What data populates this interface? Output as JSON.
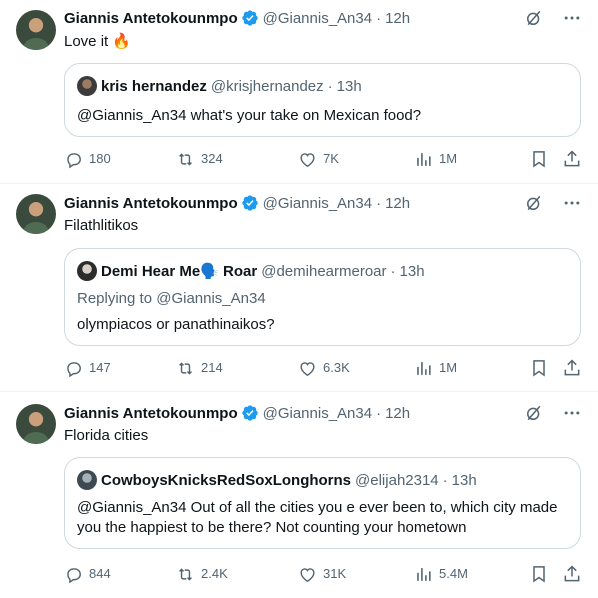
{
  "colors": {
    "accent": "#1d9bf0",
    "muted": "#536471",
    "text": "#0f1419",
    "border": "#cfd9de"
  },
  "tweets": [
    {
      "author": {
        "name": "Giannis Antetokounmpo",
        "handle": "@Giannis_An34",
        "time": "12h",
        "verified_icon": "verified-badge-icon"
      },
      "text": "Love it 🔥",
      "quote": {
        "name": "kris hernandez",
        "handle": "@krisjhernandez",
        "time": "13h",
        "replying": "",
        "lines": [
          "@Giannis_An34 what's your take on Mexican food?"
        ]
      },
      "stats": {
        "replies": "180",
        "reposts": "324",
        "likes": "7K",
        "views": "1M"
      }
    },
    {
      "author": {
        "name": "Giannis Antetokounmpo",
        "handle": "@Giannis_An34",
        "time": "12h",
        "verified_icon": "verified-badge-icon"
      },
      "text": "Filathlitikos",
      "quote": {
        "name": "Demi Hear Me🗣️ Roar",
        "handle": "@demihearmeroar",
        "time": "13h",
        "replying": "Replying to @Giannis_An34",
        "lines": [
          "olympiacos or panathinaikos?"
        ]
      },
      "stats": {
        "replies": "147",
        "reposts": "214",
        "likes": "6.3K",
        "views": "1M"
      }
    },
    {
      "author": {
        "name": "Giannis Antetokounmpo",
        "handle": "@Giannis_An34",
        "time": "12h",
        "verified_icon": "verified-badge-icon"
      },
      "text": "Florida cities",
      "quote": {
        "name": "CowboysKnicksRedSoxLonghorns",
        "handle": "@elijah2314",
        "time": "13h",
        "replying": "",
        "lines": [
          "@Giannis_An34 Out of all the cities you e ever been to, which city made",
          "you the happiest to be there? Not counting your hometown"
        ]
      },
      "stats": {
        "replies": "844",
        "reposts": "2.4K",
        "likes": "31K",
        "views": "5.4M"
      }
    }
  ],
  "separator": "·"
}
